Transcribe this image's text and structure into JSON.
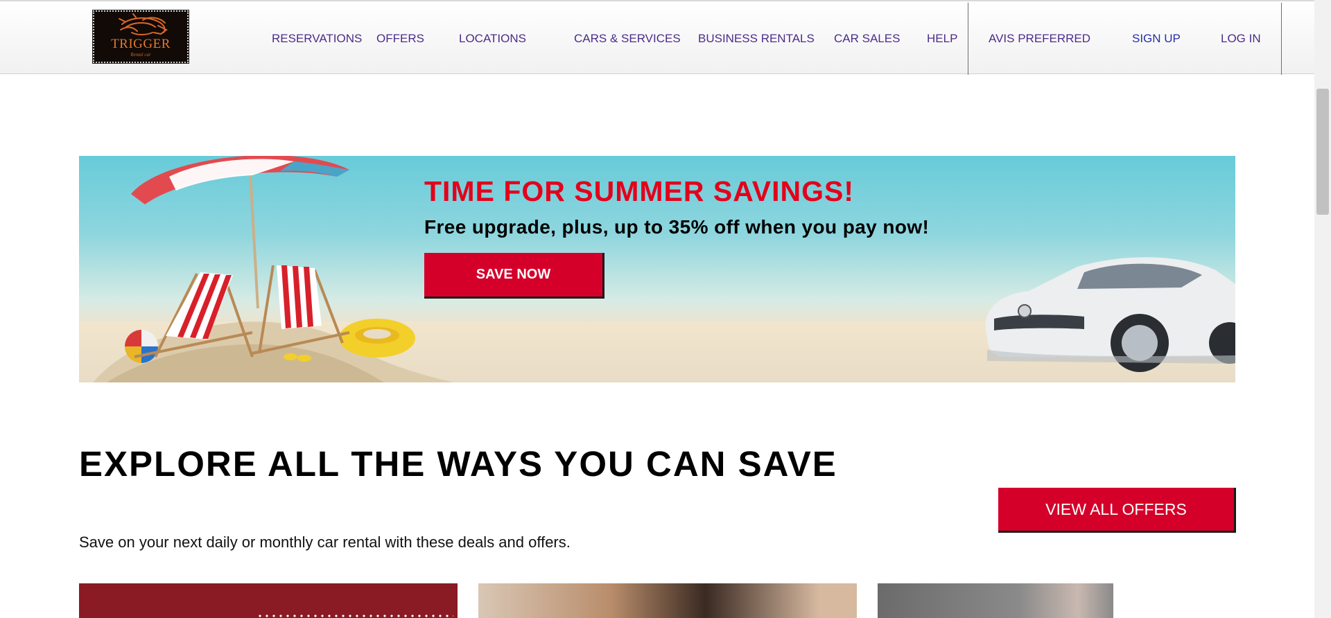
{
  "header": {
    "logo": {
      "text": "TRIGGER",
      "tagline": "Rental car",
      "icon": "lion-head-icon"
    },
    "nav": [
      {
        "label": "RESERVATIONS"
      },
      {
        "label": "OFFERS"
      },
      {
        "label": "LOCATIONS"
      },
      {
        "label": "CARS & SERVICES"
      },
      {
        "label": "BUSINESS RENTALS"
      },
      {
        "label": "CAR SALES"
      },
      {
        "label": "HELP"
      },
      {
        "label": "AVIS PREFERRED"
      },
      {
        "label": "SIGN UP"
      },
      {
        "label": "LOG IN"
      }
    ]
  },
  "hero": {
    "title": "TIME FOR SUMMER SAVINGS!",
    "subtitle": "Free upgrade, plus, up to 35% off when you pay now!",
    "cta_label": "SAVE NOW",
    "image_alt": "beach umbrella, lounge chairs and white sedan"
  },
  "explore": {
    "title": "EXPLORE ALL THE WAYS YOU CAN SAVE",
    "description": "Save on your next daily or monthly car rental with these deals and offers.",
    "view_all_label": "VIEW ALL OFFERS"
  },
  "colors": {
    "brand_red": "#d4002a",
    "nav_text": "#4b2c8a",
    "signup_text": "#2530a8",
    "hero_title": "#e3001b"
  }
}
